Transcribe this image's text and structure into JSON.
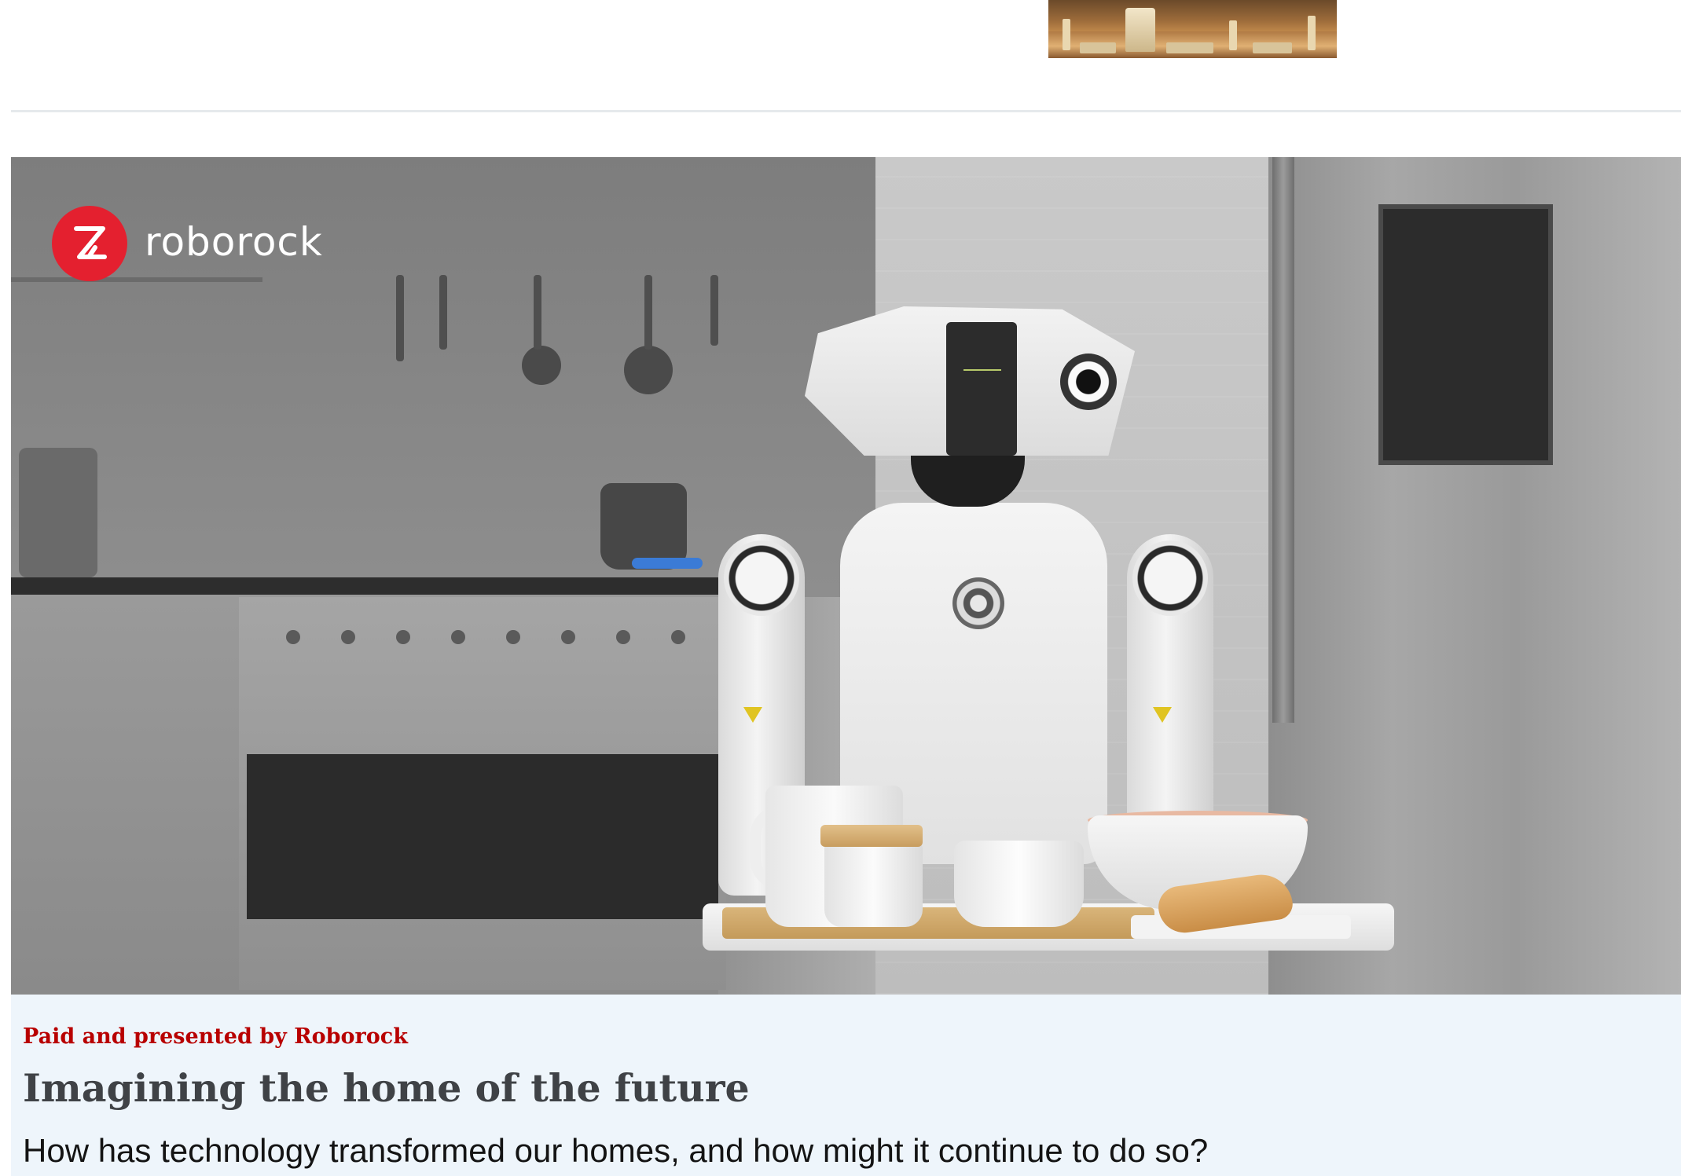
{
  "brand": {
    "logo_text": "roborock",
    "accent_color": "#e4202f"
  },
  "promo": {
    "kicker": "Paid and presented by Roborock",
    "headline": "Imagining the home of the future",
    "summary": "How has technology transformed our homes, and how might it continue to do so?",
    "kicker_color": "#b80000",
    "card_background": "#eef5fb"
  }
}
